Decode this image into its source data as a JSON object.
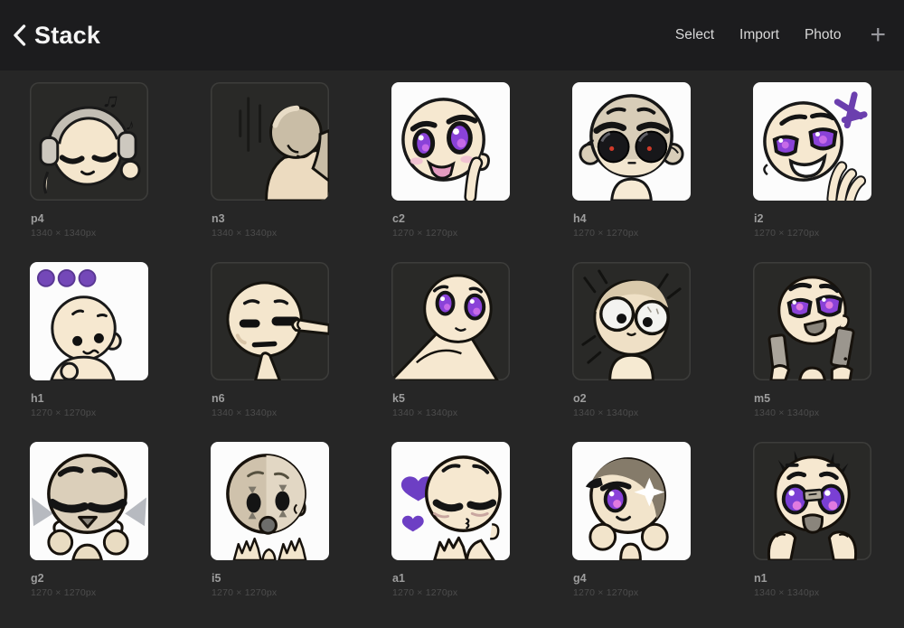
{
  "header": {
    "title": "Stack",
    "actions": {
      "select": "Select",
      "import": "Import",
      "photo": "Photo"
    },
    "plus": "+"
  },
  "grid": {
    "items": [
      {
        "name": "p4",
        "size": "1340 × 1340px",
        "background": "dark",
        "subject": "chibi listening to music with headphones"
      },
      {
        "name": "n3",
        "size": "1340 × 1340px",
        "background": "dark",
        "subject": "figure facing away in gloom"
      },
      {
        "name": "c2",
        "size": "1270 × 1270px",
        "background": "white",
        "subject": "chibi with purple eyes pointing at cheek"
      },
      {
        "name": "h4",
        "size": "1270 × 1270px",
        "background": "white",
        "subject": "chibi with huge dark eyes and red pupils"
      },
      {
        "name": "i2",
        "size": "1270 × 1270px",
        "background": "white",
        "subject": "laughing chibi with hand at chin"
      },
      {
        "name": "h1",
        "size": "1270 × 1270px",
        "background": "white",
        "subject": "chibi with three purple dots overhead"
      },
      {
        "name": "n6",
        "size": "1340 × 1340px",
        "background": "dark",
        "subject": "annoyed chibi getting cheek pulled"
      },
      {
        "name": "k5",
        "size": "1340 × 1340px",
        "background": "dark",
        "subject": "chibi reclining looking up"
      },
      {
        "name": "o2",
        "size": "1340 × 1340px",
        "background": "dark",
        "subject": "startled chibi with wide gray eyes"
      },
      {
        "name": "m5",
        "size": "1340 × 1340px",
        "background": "dark",
        "subject": "chibi holding two phones"
      },
      {
        "name": "g2",
        "size": "1270 × 1270px",
        "background": "white",
        "subject": "gray chibi cheering with closed lash eyes"
      },
      {
        "name": "i5",
        "size": "1270 × 1270px",
        "background": "white",
        "subject": "shocked clown-faced chibi with hands up"
      },
      {
        "name": "a1",
        "size": "1270 × 1270px",
        "background": "white",
        "subject": "shy chibi with purple hearts"
      },
      {
        "name": "g4",
        "size": "1270 × 1270px",
        "background": "white",
        "subject": "chibi with sparkling purple eye"
      },
      {
        "name": "n1",
        "size": "1340 × 1340px",
        "background": "dark",
        "subject": "crying chibi with hands on cheeks"
      }
    ]
  },
  "colors": {
    "header_bg": "#1c1c1e",
    "content_bg": "#262626",
    "tile_dark": "#292927",
    "tile_light": "#fcfcfc",
    "accent_purple": "#8a42d8",
    "label": "#9d9d9d",
    "dimensions": "#4c4c4c"
  }
}
